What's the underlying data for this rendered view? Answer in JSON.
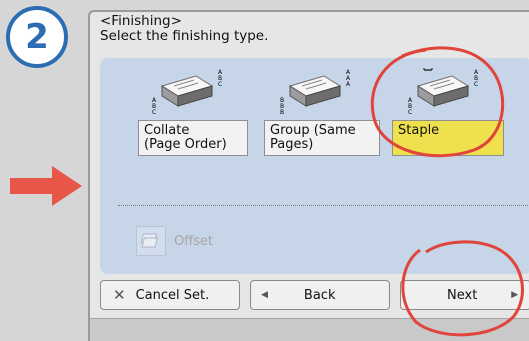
{
  "step_number": "2",
  "header": {
    "title": "<Finishing>",
    "subtitle": "Select the finishing type."
  },
  "options": [
    {
      "line1": "Collate",
      "line2": "(Page Order)",
      "selected": false
    },
    {
      "line1": "Group (Same",
      "line2": "Pages)",
      "selected": false
    },
    {
      "line1": "Staple",
      "line2": "",
      "selected": true
    }
  ],
  "offset": {
    "label": "Offset",
    "enabled": false
  },
  "footer": {
    "cancel_label": "Cancel Set.",
    "back_label": "Back",
    "next_label": "Next"
  },
  "colors": {
    "badge": "#2b6cb3",
    "arrow": "#e8564a",
    "annotation_circle": "#e0443a",
    "selected_option": "#efe04d",
    "panel": "#c6d5e7"
  }
}
